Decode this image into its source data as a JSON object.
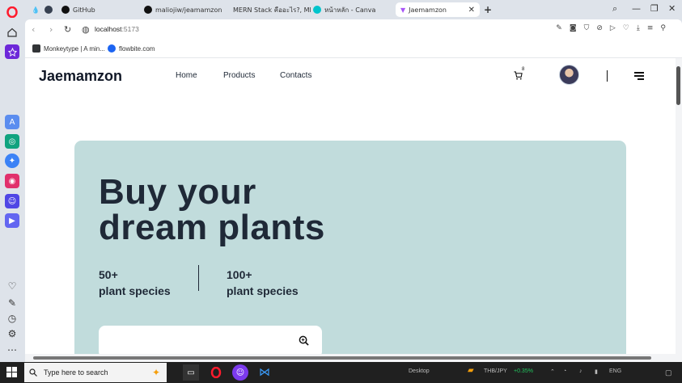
{
  "browser": {
    "tabs": [
      {
        "label": "GitHub"
      },
      {
        "label": "maliojiw/jeamamzon"
      },
      {
        "label": "MERN Stack คืออะไร?, MER"
      },
      {
        "label": "หน้าหลัก - Canva"
      },
      {
        "label": "Jaemamzon"
      }
    ],
    "new_tab": "+",
    "url_host": "localhost",
    "url_port": ":5173",
    "bookmarks": [
      {
        "label": "Monkeytype | A min..."
      },
      {
        "label": "flowbite.com"
      }
    ]
  },
  "page": {
    "logo": "Jaemamzon",
    "nav": [
      "Home",
      "Products",
      "Contacts"
    ],
    "cart_count": "8",
    "hero": {
      "title_line1": "Buy your",
      "title_line2": "dream plants",
      "stats": [
        {
          "value": "50+",
          "label": "plant species"
        },
        {
          "value": "100+",
          "label": "plant species"
        }
      ],
      "search_placeholder": ""
    }
  },
  "taskbar": {
    "search_placeholder": "Type here to search",
    "desktop_label": "Desktop",
    "ticker": "THB/JPY",
    "ticker_change": "+0.35%",
    "language": "ENG"
  },
  "colors": {
    "hero_bg": "#c1dcdc",
    "text_dark": "#1f2937",
    "opera_red": "#ff1b2d"
  }
}
